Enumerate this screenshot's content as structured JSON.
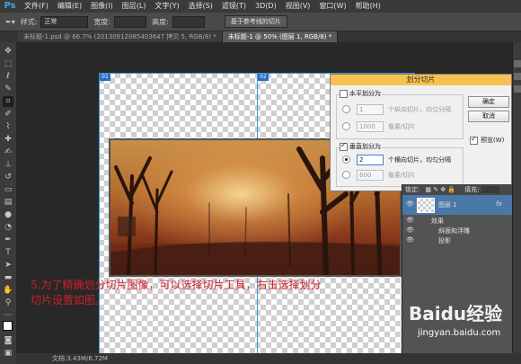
{
  "app": {
    "logo": "Ps"
  },
  "menu": [
    "文件(F)",
    "编辑(E)",
    "图像(I)",
    "图层(L)",
    "文字(Y)",
    "选择(S)",
    "滤镜(T)",
    "3D(D)",
    "视图(V)",
    "窗口(W)",
    "帮助(H)"
  ],
  "options": {
    "style_label": "样式:",
    "style_value": "正常",
    "width_label": "宽度:",
    "height_label": "高度:",
    "guides_button": "基于参考线的切片"
  },
  "tabs": [
    {
      "label": "未标题-1.psd @ 66.7% (20130912085403647 拷贝 5, RGB/8) *",
      "active": false
    },
    {
      "label": "未标题-1 @ 50% (图层 1, RGB/8) *",
      "active": true
    }
  ],
  "slice_badges": [
    "01",
    "02"
  ],
  "annotation": {
    "line1": "5.为了精确划分切片图像，可以选择切片工具，右击选择划分",
    "line2": "切片设置如图。"
  },
  "dialog": {
    "title": "划分切片",
    "ok": "确定",
    "cancel": "取消",
    "preview_label": "预览(W)",
    "horizontal": {
      "label": "水平划分为",
      "checked": false,
      "count_value": "1",
      "count_suffix": "个纵向切片，均匀分隔",
      "pixel_value": "1000",
      "pixel_suffix": "像素/切片"
    },
    "vertical": {
      "label": "垂直划分为",
      "checked": true,
      "count_value": "2",
      "count_suffix": "个横向切片，均匀分隔",
      "pixel_value": "600",
      "pixel_suffix": "像素/切片"
    }
  },
  "layers_panel": {
    "toolbar_label": "锁定:",
    "fill_label": "填充:",
    "layer_name": "图层 1",
    "fx": "fx",
    "effects_label": "效果",
    "effect1": "斜面和浮雕",
    "effect2": "投影"
  },
  "status": {
    "text": "文档:3.43M/6.72M"
  },
  "watermark": {
    "brand": "Baidu经验",
    "url": "jingyan.baidu.com"
  }
}
